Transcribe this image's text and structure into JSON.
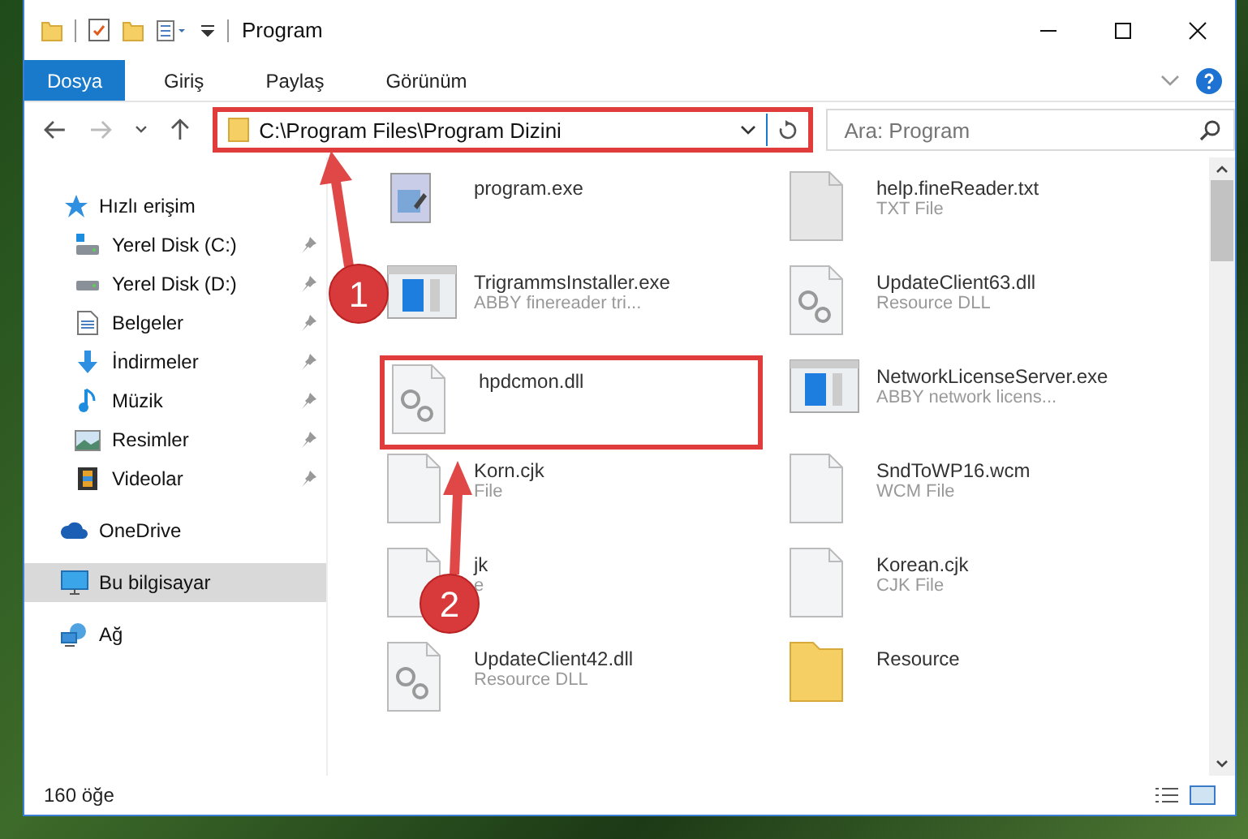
{
  "window": {
    "title": "Program"
  },
  "ribbon": {
    "tabs": [
      {
        "label": "Dosya",
        "selected": true
      },
      {
        "label": "Giriş",
        "selected": false
      },
      {
        "label": "Paylaş",
        "selected": false
      },
      {
        "label": "Görünüm",
        "selected": false
      }
    ]
  },
  "address": {
    "path": "C:\\Program Files\\Program Dizini",
    "highlighted": true
  },
  "search": {
    "placeholder": "Ara: Program"
  },
  "sidebar": {
    "items": [
      {
        "label": "Hızlı erişim",
        "kind": "star",
        "selected": false,
        "children": [
          {
            "label": "Yerel Disk (C:)",
            "kind": "system",
            "pinned": true,
            "selected": false
          },
          {
            "label": "Yerel Disk (D:)",
            "kind": "drive",
            "pinned": true,
            "selected": false
          },
          {
            "label": "Belgeler",
            "kind": "documents",
            "pinned": true,
            "selected": false
          },
          {
            "label": "İndirmeler",
            "kind": "downloads",
            "pinned": true,
            "selected": false
          },
          {
            "label": "Müzik",
            "kind": "music",
            "pinned": true,
            "selected": false
          },
          {
            "label": "Resimler",
            "kind": "pictures",
            "pinned": true,
            "selected": false
          },
          {
            "label": "Videolar",
            "kind": "videos",
            "pinned": true,
            "selected": false
          }
        ]
      },
      {
        "label": "OneDrive",
        "kind": "cloud",
        "selected": false
      },
      {
        "label": "Bu bilgisayar",
        "kind": "computer",
        "selected": true
      },
      {
        "label": "Ağ",
        "kind": "network",
        "selected": false
      }
    ]
  },
  "files": {
    "columns": [
      [
        {
          "name": "program.exe",
          "kind": "app",
          "highlighted": false
        },
        {
          "name": "TrigrammsInstaller.exe",
          "type": "ABBY finereader tri...",
          "kind": "window",
          "highlighted": false
        },
        {
          "name": "hpdcmon.dll",
          "kind": "dll",
          "highlighted": true
        },
        {
          "name": "Korn.cjk",
          "type": "File",
          "kind": "blank",
          "highlighted": false
        },
        {
          "name": "jk",
          "type": "e",
          "kind": "blank",
          "highlighted": false
        },
        {
          "name": "UpdateClient42.dll",
          "type": "Resource DLL",
          "kind": "dll",
          "highlighted": false
        }
      ],
      [
        {
          "name": "help.fineReader.txt",
          "type": "TXT File",
          "kind": "txt",
          "highlighted": false
        },
        {
          "name": "UpdateClient63.dll",
          "type": "Resource DLL",
          "kind": "dll",
          "highlighted": false
        },
        {
          "name": "NetworkLicenseServer.exe",
          "type": "ABBY network licens...",
          "kind": "window",
          "highlighted": false
        },
        {
          "name": "SndToWP16.wcm",
          "type": "WCM File",
          "kind": "blank",
          "highlighted": false
        },
        {
          "name": "Korean.cjk",
          "type": "CJK File",
          "kind": "blank",
          "highlighted": false
        },
        {
          "name": "Resource",
          "kind": "folder",
          "highlighted": false
        }
      ]
    ]
  },
  "callouts": [
    {
      "number": "1"
    },
    {
      "number": "2"
    }
  ],
  "status_bar": {
    "count": "160 öğe"
  }
}
